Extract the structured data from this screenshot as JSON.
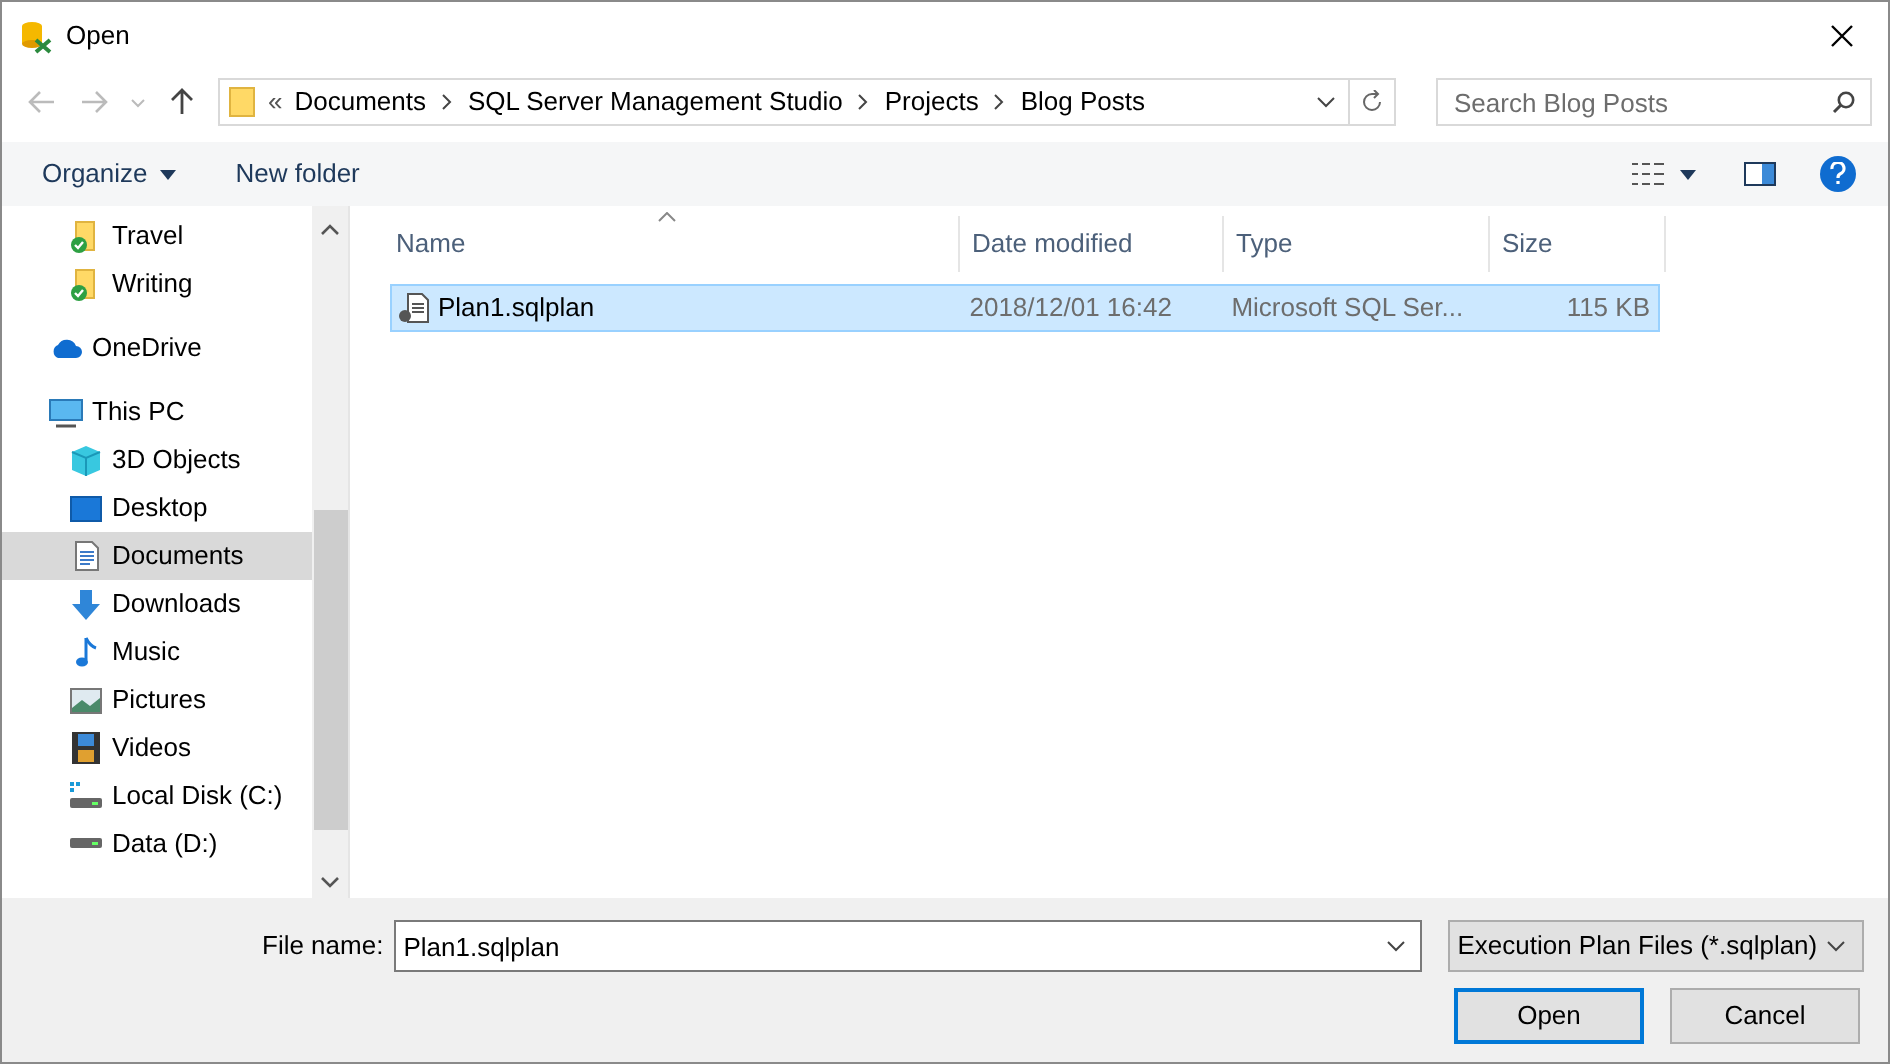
{
  "window": {
    "title": "Open"
  },
  "address": {
    "crumbs": [
      "Documents",
      "SQL Server Management Studio",
      "Projects",
      "Blog Posts"
    ],
    "overflow": "«"
  },
  "search": {
    "placeholder": "Search Blog Posts"
  },
  "toolbar": {
    "organize": "Organize",
    "new_folder": "New folder"
  },
  "sidebar": {
    "items": [
      {
        "label": "Travel",
        "kind": "synced-folder",
        "selected": false
      },
      {
        "label": "Writing",
        "kind": "synced-folder",
        "selected": false
      },
      {
        "label": "OneDrive",
        "kind": "cloud",
        "selected": false
      },
      {
        "label": "This PC",
        "kind": "pc",
        "selected": false,
        "children": [
          {
            "label": "3D Objects",
            "kind": "cube",
            "selected": false
          },
          {
            "label": "Desktop",
            "kind": "desktop",
            "selected": false
          },
          {
            "label": "Documents",
            "kind": "documents",
            "selected": true
          },
          {
            "label": "Downloads",
            "kind": "downloads",
            "selected": false
          },
          {
            "label": "Music",
            "kind": "music",
            "selected": false
          },
          {
            "label": "Pictures",
            "kind": "pictures",
            "selected": false
          },
          {
            "label": "Videos",
            "kind": "videos",
            "selected": false
          },
          {
            "label": "Local Disk (C:)",
            "kind": "system-disk",
            "selected": false
          },
          {
            "label": "Data (D:)",
            "kind": "disk",
            "selected": false
          }
        ]
      }
    ]
  },
  "table": {
    "columns": [
      "Name",
      "Date modified",
      "Type",
      "Size"
    ],
    "rows": [
      {
        "cells": [
          "Plan1.sqlplan",
          "2018/12/01 16:42",
          "Microsoft SQL Ser...",
          "115 KB"
        ],
        "selected": true
      }
    ]
  },
  "footer": {
    "file_name_label": "File name:",
    "file_name": "Plan1.sqlplan",
    "filter": "Execution Plan Files (*.sqlplan)",
    "buttons": [
      "Open",
      "Cancel"
    ]
  }
}
